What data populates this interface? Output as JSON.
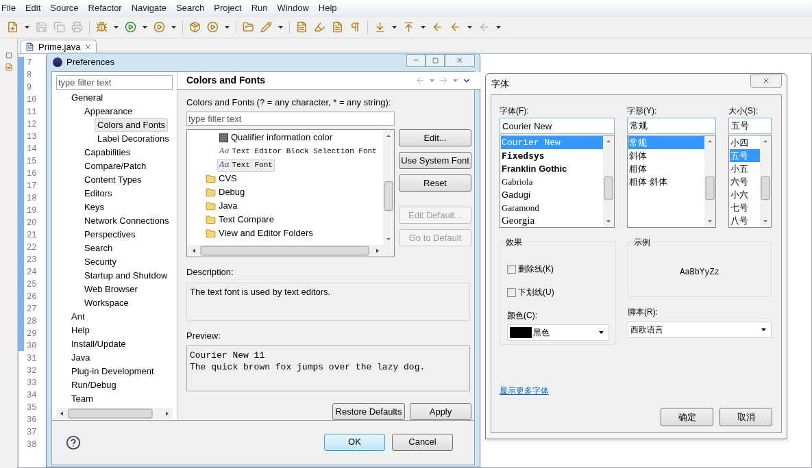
{
  "menu": [
    "File",
    "Edit",
    "Source",
    "Refactor",
    "Navigate",
    "Search",
    "Project",
    "Run",
    "Window",
    "Help"
  ],
  "editor": {
    "tab": {
      "label": "Prime.java"
    },
    "line_numbers": [
      "7",
      "8",
      "9",
      "10",
      "11",
      "12",
      "13",
      "14",
      "15",
      "16",
      "17",
      "18",
      "19",
      "20",
      "21",
      "22",
      "23",
      "24",
      "25",
      "26",
      "27",
      "28",
      "29",
      "30",
      "31",
      "32",
      "33",
      "34",
      "35",
      "36",
      "37",
      "38"
    ]
  },
  "preferences": {
    "title": "Preferences",
    "filter": {
      "placeholder": "type filter text"
    },
    "tree": [
      {
        "label": "General",
        "selected": false,
        "children": [
          {
            "label": "Appearance",
            "selected": false,
            "children": [
              {
                "label": "Colors and Fonts",
                "selected": true
              },
              {
                "label": "Label Decorations",
                "selected": false
              }
            ]
          },
          {
            "label": "Capabilities",
            "selected": false
          },
          {
            "label": "Compare/Patch",
            "selected": false
          },
          {
            "label": "Content Types",
            "selected": false
          },
          {
            "label": "Editors",
            "selected": false
          },
          {
            "label": "Keys",
            "selected": false
          },
          {
            "label": "Network Connections",
            "selected": false
          },
          {
            "label": "Perspectives",
            "selected": false
          },
          {
            "label": "Search",
            "selected": false
          },
          {
            "label": "Security",
            "selected": false
          },
          {
            "label": "Startup and Shutdow",
            "selected": false
          },
          {
            "label": "Web Browser",
            "selected": false
          },
          {
            "label": "Workspace",
            "selected": false
          }
        ]
      },
      {
        "label": "Ant",
        "selected": false
      },
      {
        "label": "Help",
        "selected": false
      },
      {
        "label": "Install/Update",
        "selected": false
      },
      {
        "label": "Java",
        "selected": false
      },
      {
        "label": "Plug-in Development",
        "selected": false
      },
      {
        "label": "Run/Debug",
        "selected": false
      },
      {
        "label": "Team",
        "selected": false
      }
    ],
    "page_title": "Colors and Fonts",
    "filter_label": "Colors and Fonts (? = any character, * = any string):",
    "page_filter": {
      "placeholder": "type filter text"
    },
    "entries": [
      {
        "kind": "color",
        "label": "Qualifier information color",
        "selected": false,
        "color": "#707070"
      },
      {
        "kind": "font",
        "icon": "Aa",
        "label": "Text Editor Block Selection Font",
        "selected": false
      },
      {
        "kind": "font",
        "icon": "Aa",
        "label": "Text Font",
        "selected": true
      },
      {
        "kind": "folder",
        "label": "CVS",
        "selected": false
      },
      {
        "kind": "folder",
        "label": "Debug",
        "selected": false
      },
      {
        "kind": "folder",
        "label": "Java",
        "selected": false
      },
      {
        "kind": "folder",
        "label": "Text Compare",
        "selected": false
      },
      {
        "kind": "folder",
        "label": "View and Editor Folders",
        "selected": false
      }
    ],
    "side_buttons": [
      {
        "label": "Edit...",
        "disabled": false
      },
      {
        "label": "Use System Font",
        "disabled": false
      },
      {
        "label": "Reset",
        "disabled": false
      },
      {
        "label": "Edit Default...",
        "disabled": true
      },
      {
        "label": "Go to Default",
        "disabled": true
      }
    ],
    "description": {
      "label": "Description:",
      "text": "The text font is used by text editors."
    },
    "preview": {
      "label": "Preview:",
      "lines": [
        "Courier New 11",
        "The quick brown fox jumps over the lazy dog."
      ]
    },
    "page_buttons": [
      "Restore Defaults",
      "Apply"
    ],
    "footer_buttons": [
      {
        "label": "OK",
        "default": true
      },
      {
        "label": "Cancel",
        "default": false
      }
    ]
  },
  "font_dialog": {
    "title": "字体",
    "font": {
      "label": "字体(F):",
      "value": "Courier New",
      "options": [
        {
          "label": "Courier New",
          "kind": "mono",
          "selected": true
        },
        {
          "label": "Fixedsys",
          "kind": "bold_mono",
          "selected": false
        },
        {
          "label": "Franklin Gothic",
          "kind": "bold",
          "selected": false
        },
        {
          "label": "Gabriola",
          "kind": "script",
          "selected": false
        },
        {
          "label": "Gadugi",
          "kind": "sans",
          "selected": false
        },
        {
          "label": "Garamond",
          "kind": "serif",
          "selected": false
        },
        {
          "label": "Georgia",
          "kind": "serif_large",
          "selected": false
        }
      ]
    },
    "style": {
      "label": "字形(Y):",
      "value": "常规",
      "options": [
        {
          "label": "常规",
          "selected": true
        },
        {
          "label": "斜体",
          "selected": false
        },
        {
          "label": "粗体",
          "selected": false
        },
        {
          "label": "粗体 斜体",
          "selected": false
        }
      ]
    },
    "size": {
      "label": "大小(S):",
      "value": "五号",
      "options": [
        {
          "label": "小四",
          "selected": false
        },
        {
          "label": "五号",
          "selected": true
        },
        {
          "label": "小五",
          "selected": false
        },
        {
          "label": "六号",
          "selected": false
        },
        {
          "label": "小六",
          "selected": false
        },
        {
          "label": "七号",
          "selected": false
        },
        {
          "label": "八号",
          "selected": false
        }
      ]
    },
    "effects": {
      "label": "效果",
      "checkboxes": [
        {
          "label": "删除线(K)",
          "checked": false
        },
        {
          "label": "下划线(U)",
          "checked": false
        }
      ],
      "color_label": "颜色(C):",
      "color": {
        "label": "黑色",
        "color": "#000000"
      }
    },
    "sample": {
      "label": "示例",
      "text": "AaBbYyZz"
    },
    "script": {
      "label": "脚本(R):",
      "value": "西欧语言"
    },
    "link": "显示更多字体",
    "buttons": [
      "确定",
      "取消"
    ]
  }
}
